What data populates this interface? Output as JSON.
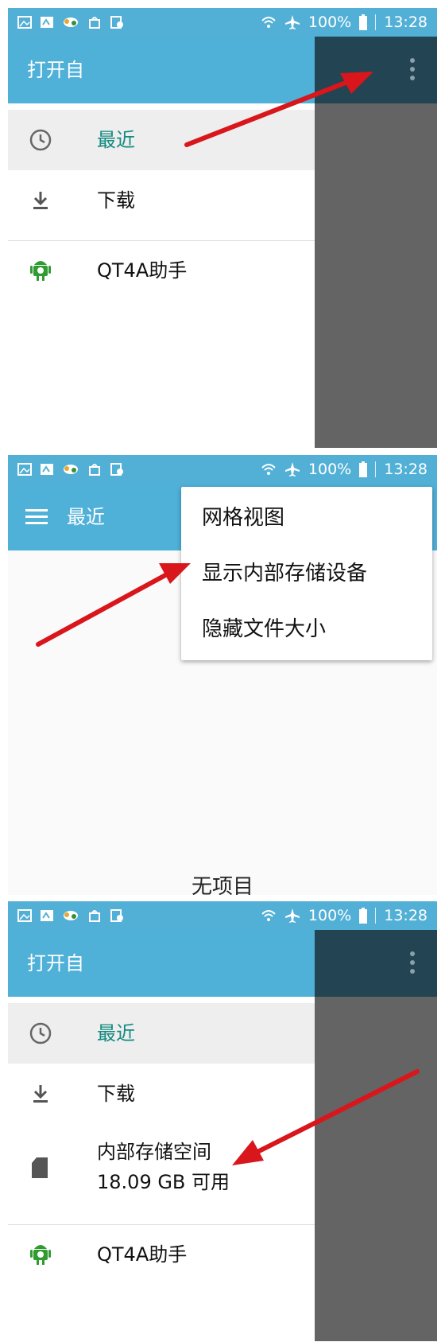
{
  "status_bar": {
    "battery": "100%",
    "time": "13:28"
  },
  "colors": {
    "statusbar": "#52b0d6",
    "appbar": "#4fb0d8",
    "accent": "#138b80",
    "scrim": "#646464",
    "arrow": "#d8161b"
  },
  "panel1": {
    "drawer_title": "打开自",
    "items": [
      {
        "icon": "clock-icon",
        "label": "最近"
      },
      {
        "icon": "download-icon",
        "label": "下载"
      },
      {
        "icon": "android-icon",
        "label": "QT4A助手"
      }
    ]
  },
  "panel2": {
    "toolbar_title": "最近",
    "menu": [
      "网格视图",
      "显示内部存储设备",
      "隐藏文件大小"
    ],
    "empty_text": "无项目"
  },
  "panel3": {
    "drawer_title": "打开自",
    "items": [
      {
        "icon": "clock-icon",
        "label": "最近"
      },
      {
        "icon": "download-icon",
        "label": "下载"
      },
      {
        "icon": "sd-card-icon",
        "label": "内部存储空间",
        "sublabel": "18.09 GB 可用"
      },
      {
        "icon": "android-icon",
        "label": "QT4A助手"
      }
    ]
  }
}
